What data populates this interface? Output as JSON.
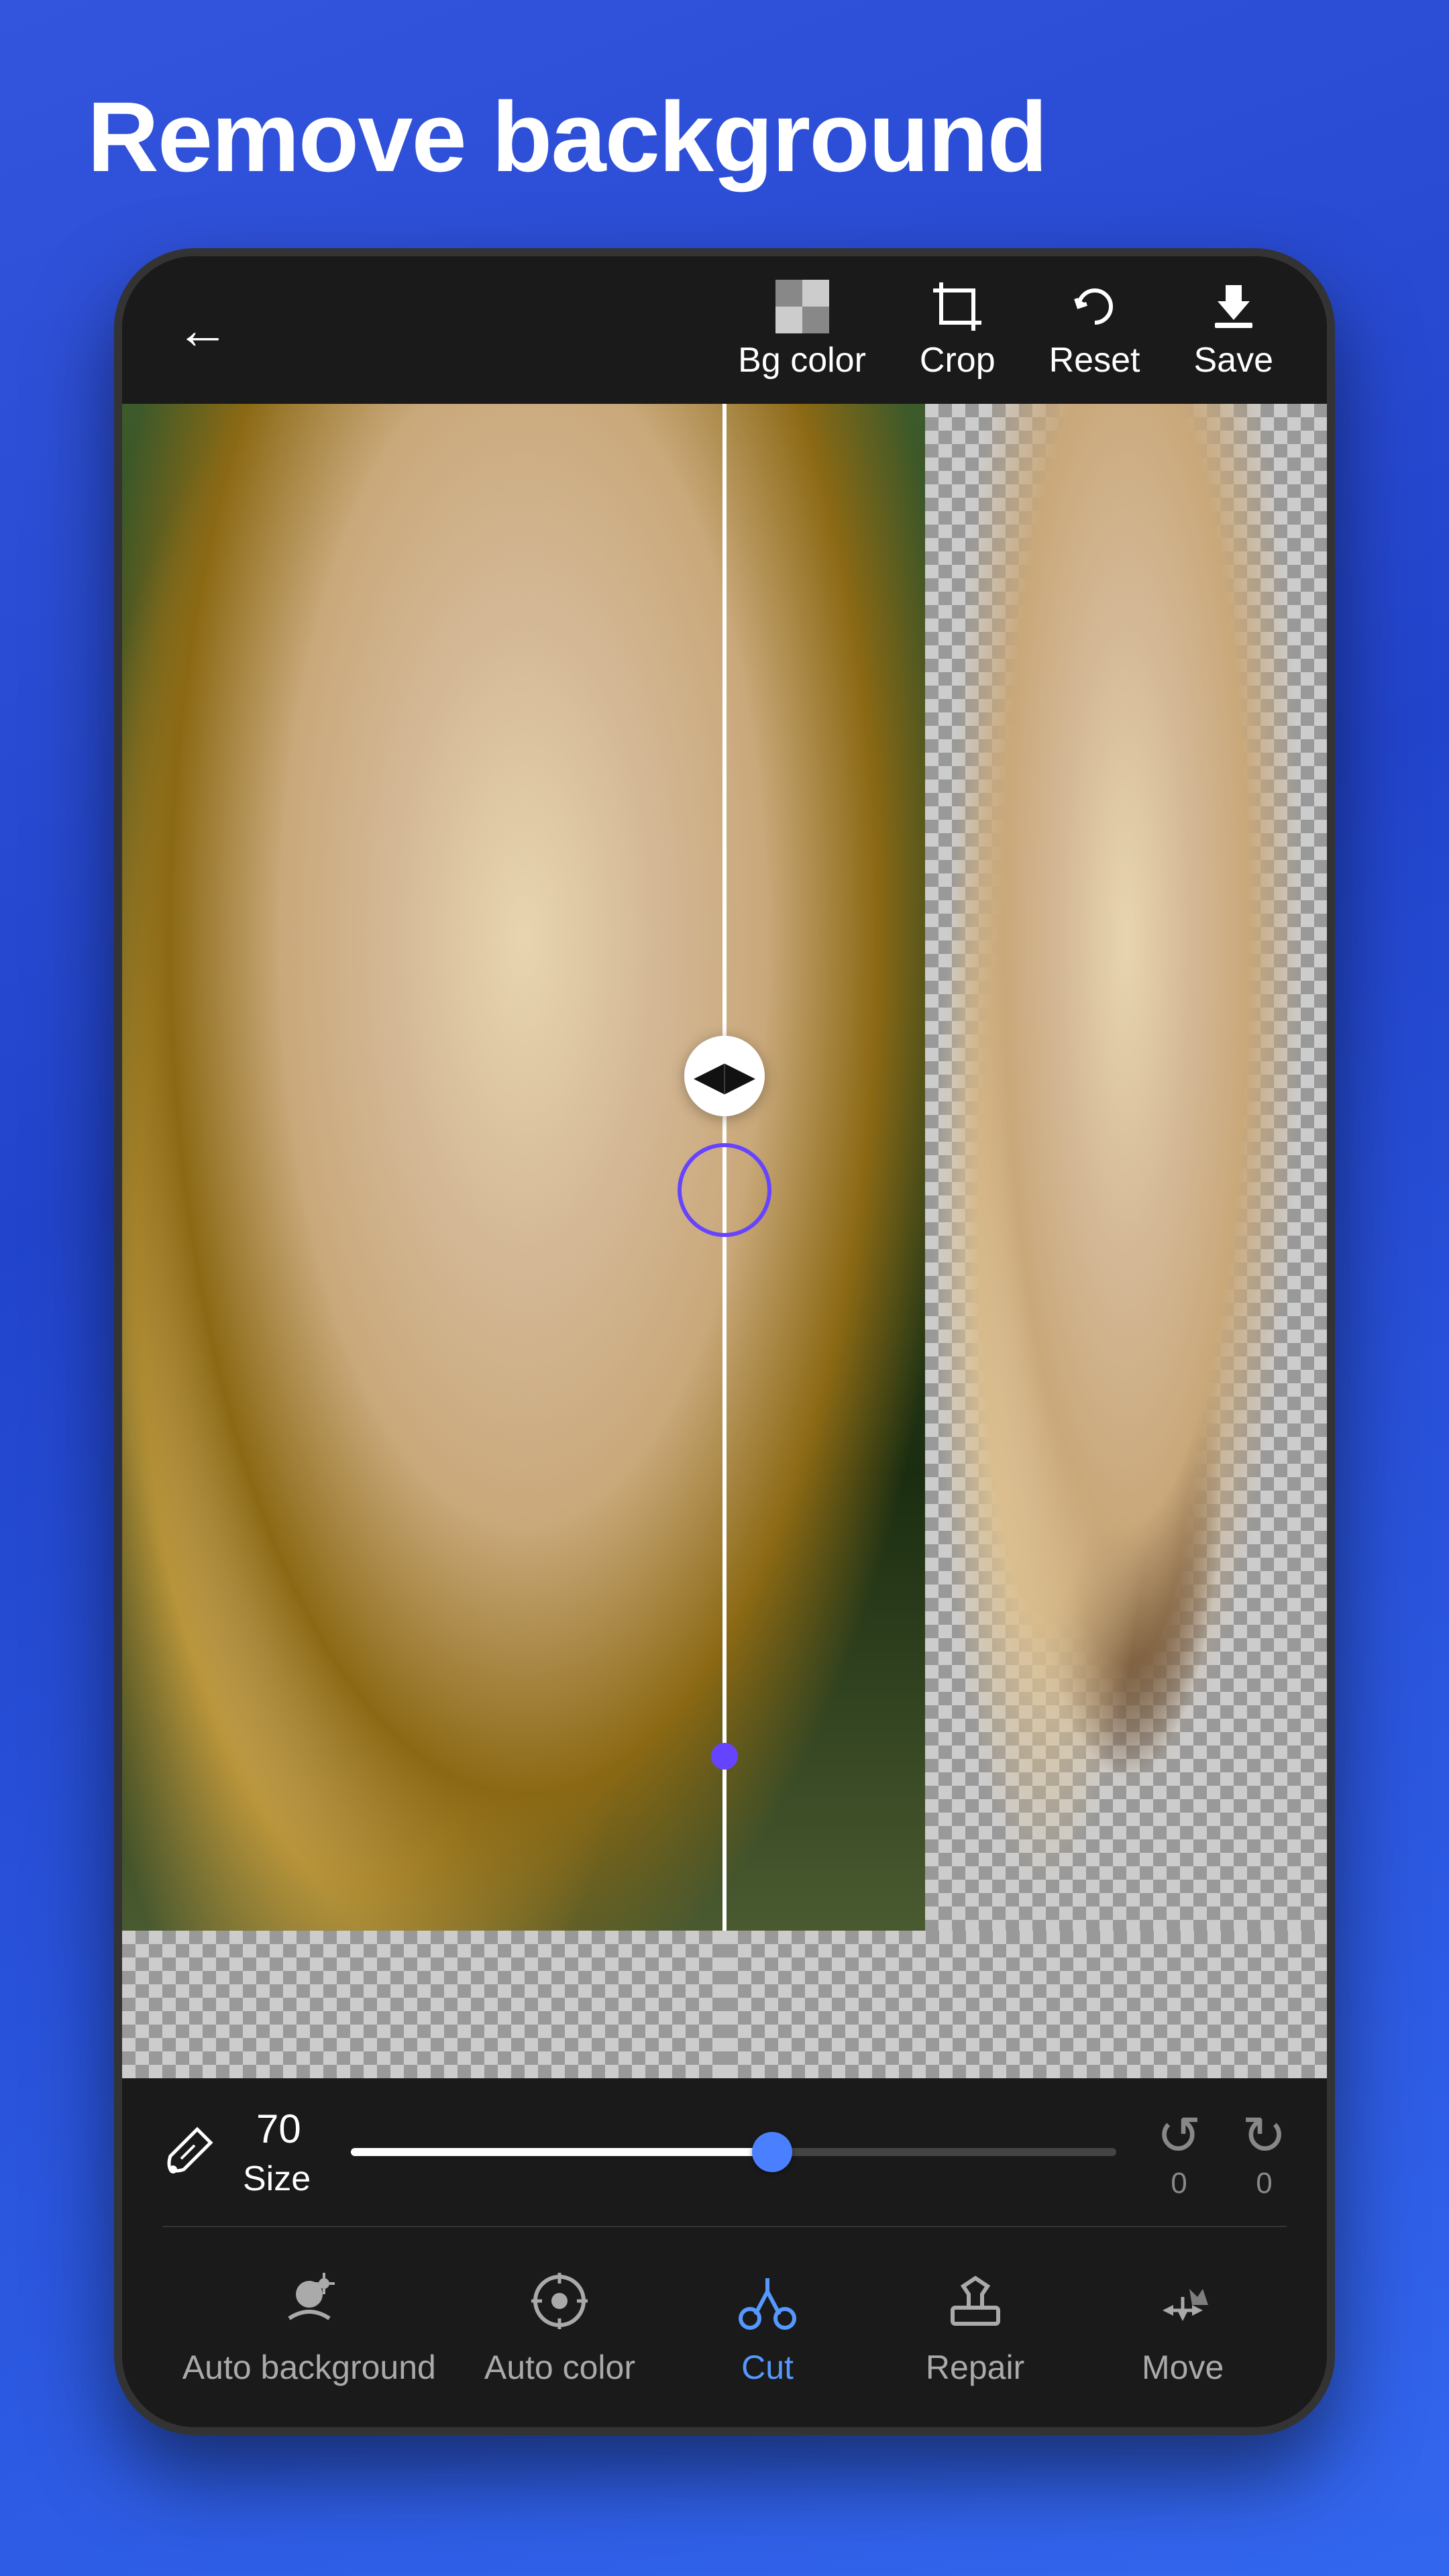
{
  "page": {
    "title": "Remove background"
  },
  "toolbar": {
    "back_label": "←",
    "bg_color_label": "Bg color",
    "crop_label": "Crop",
    "reset_label": "Reset",
    "save_label": "Save"
  },
  "image": {
    "alt": "Dog portrait split view - original and background removed"
  },
  "controls": {
    "size_label": "Size",
    "size_value": "70",
    "undo_value": "0",
    "redo_value": "0"
  },
  "tools": [
    {
      "id": "auto-background",
      "label": "Auto background",
      "active": false
    },
    {
      "id": "auto-color",
      "label": "Auto color",
      "active": false
    },
    {
      "id": "cut",
      "label": "Cut",
      "active": true
    },
    {
      "id": "repair",
      "label": "Repair",
      "active": false
    },
    {
      "id": "move",
      "label": "Move",
      "active": false
    }
  ],
  "colors": {
    "bg_gradient_start": "#3355dd",
    "bg_gradient_end": "#2244cc",
    "toolbar_bg": "#1a1a1a",
    "phone_bg": "#111111",
    "active_tool": "#5599ff",
    "inactive_tool": "#aaaaaa",
    "divider": "#ffffff",
    "slider_thumb": "#4a7fff"
  }
}
